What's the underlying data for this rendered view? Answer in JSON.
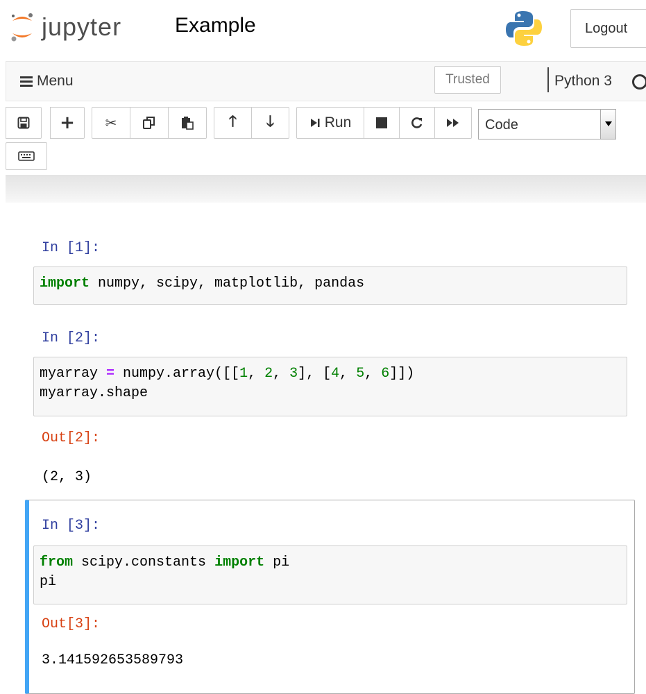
{
  "header": {
    "logo_text": "jupyter",
    "notebook_title": "Example",
    "logout_label": "Logout"
  },
  "menubar": {
    "menu_label": "Menu",
    "trusted_label": "Trusted",
    "kernel_name": "Python 3"
  },
  "toolbar": {
    "run_label": "Run",
    "cell_type": "Code"
  },
  "cells": [
    {
      "in_prompt": "In [1]:",
      "source": [
        [
          {
            "t": "import",
            "c": "kw"
          },
          {
            "t": " numpy, scipy, matplotlib, pandas",
            "c": ""
          }
        ]
      ]
    },
    {
      "in_prompt": "In [2]:",
      "source": [
        [
          {
            "t": "myarray ",
            "c": ""
          },
          {
            "t": "=",
            "c": "op"
          },
          {
            "t": " numpy.array([[",
            "c": ""
          },
          {
            "t": "1",
            "c": "num"
          },
          {
            "t": ", ",
            "c": ""
          },
          {
            "t": "2",
            "c": "num"
          },
          {
            "t": ", ",
            "c": ""
          },
          {
            "t": "3",
            "c": "num"
          },
          {
            "t": "], [",
            "c": ""
          },
          {
            "t": "4",
            "c": "num"
          },
          {
            "t": ", ",
            "c": ""
          },
          {
            "t": "5",
            "c": "num"
          },
          {
            "t": ", ",
            "c": ""
          },
          {
            "t": "6",
            "c": "num"
          },
          {
            "t": "]])",
            "c": ""
          }
        ],
        [
          {
            "t": "myarray.shape",
            "c": ""
          }
        ]
      ],
      "out_prompt": "Out[2]:",
      "output": "(2, 3)"
    },
    {
      "in_prompt": "In [3]:",
      "source": [
        [
          {
            "t": "from",
            "c": "kw"
          },
          {
            "t": " scipy.constants ",
            "c": ""
          },
          {
            "t": "import",
            "c": "kw"
          },
          {
            "t": " pi",
            "c": ""
          }
        ],
        [
          {
            "t": "pi",
            "c": ""
          }
        ]
      ],
      "out_prompt": "Out[3]:",
      "output": "3.141592653589793"
    }
  ],
  "colors": {
    "prompt_in": "#303f9f",
    "prompt_out": "#d84315",
    "keyword": "#008000",
    "operator": "#aa22ff",
    "number": "#008000",
    "selected_border": "#42a5f5"
  },
  "icons": [
    "jupyter-logo-icon",
    "python-logo-icon",
    "hamburger-icon",
    "save-icon",
    "plus-icon",
    "cut-icon",
    "copy-icon",
    "paste-icon",
    "arrow-up-icon",
    "arrow-down-icon",
    "run-icon",
    "stop-icon",
    "restart-icon",
    "fast-forward-icon",
    "keyboard-icon"
  ]
}
